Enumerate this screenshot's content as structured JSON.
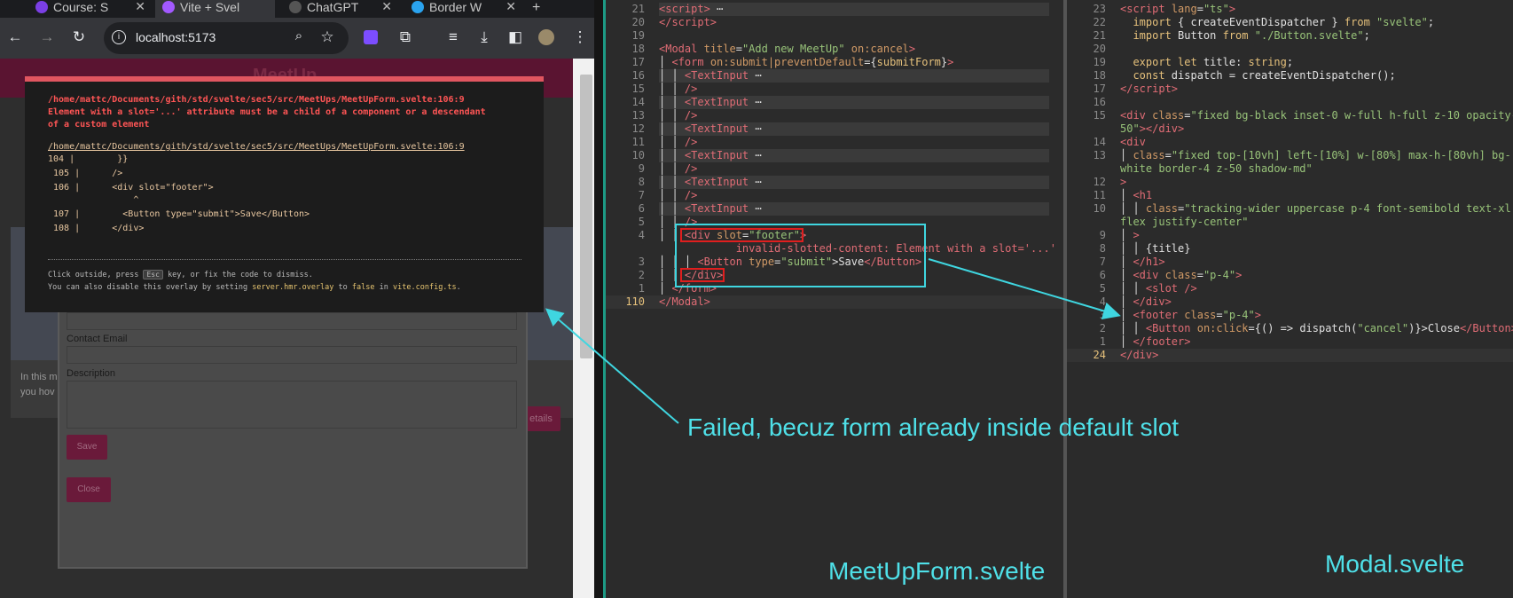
{
  "browser": {
    "tabs": [
      {
        "label": "Course: S",
        "fav_color": "#7b3fe4"
      },
      {
        "label": "Vite + Svel",
        "fav_color": "#a259ff"
      },
      {
        "label": "ChatGPT",
        "fav_color": "#3a3a3a"
      },
      {
        "label": "Border W",
        "fav_color": "#2aa3ef"
      }
    ],
    "new_tab": "+",
    "url": "localhost:5173",
    "page": {
      "logo": "MeetUp",
      "contact_email_label": "Contact Email",
      "description_label": "Description",
      "save_button": "Save",
      "close_button": "Close",
      "bg_details_button": "etails",
      "bg_text_1": "In this m",
      "bg_text_2": "you hov"
    },
    "overlay": {
      "file": "/home/mattc/Documents/gith/std/svelte/sec5/src/MeetUps/MeetUpForm.svelte:106:9",
      "message_1": "Element with a slot='...' attribute must be a child of a component or a descendant",
      "message_2": "of a custom element",
      "link": "/home/mattc/Documents/gith/std/svelte/sec5/src/MeetUps/MeetUpForm.svelte:106:9",
      "code": [
        "104 |        }}",
        " 105 |      />",
        " 106 |      <div slot=\"footer\">",
        "                ^",
        " 107 |        <Button type=\"submit\">Save</Button>",
        " 108 |      </div>"
      ],
      "tip_1a": "Click outside, press",
      "tip_key": "Esc",
      "tip_1b": "key, or fix the code to dismiss.",
      "tip_2a": "You can also disable this overlay by setting",
      "tip_2b": "server.hmr.overlay",
      "tip_2c": "to",
      "tip_2d": "false",
      "tip_2e": "in",
      "tip_2f": "vite.config.ts",
      "tip_2g": "."
    }
  },
  "editor_left": {
    "file_caption": "MeetUpForm.svelte",
    "lines": [
      {
        "n": "21",
        "html": "<span class='t'>&lt;script&gt;</span> <span class='p'>⋯</span>",
        "fold": true
      },
      {
        "n": "20",
        "html": "<span class='t'>&lt;/script&gt;</span>"
      },
      {
        "n": "19",
        "html": ""
      },
      {
        "n": "18",
        "html": "<span class='t'>&lt;Modal</span> <span class='k'>title</span>=<span class='s'>\"Add new MeetUp\"</span> <span class='k'>on:cancel</span><span class='t'>&gt;</span>"
      },
      {
        "n": "17",
        "html": "│ <span class='t'>&lt;form</span> <span class='k'>on:submit|preventDefault</span>={<span class='kw'>submitForm</span>}<span class='t'>&gt;</span>"
      },
      {
        "n": "16",
        "html": "│ │ <span class='t'>&lt;TextInput</span> ⋯",
        "fold": true
      },
      {
        "n": "15",
        "html": "│ │ <span class='t'>/&gt;</span>"
      },
      {
        "n": "14",
        "html": "│ │ <span class='t'>&lt;TextInput</span> ⋯",
        "fold": true
      },
      {
        "n": "13",
        "html": "│ │ <span class='t'>/&gt;</span>"
      },
      {
        "n": "12",
        "html": "│ │ <span class='t'>&lt;TextInput</span> ⋯",
        "fold": true
      },
      {
        "n": "11",
        "html": "│ │ <span class='t'>/&gt;</span>"
      },
      {
        "n": "10",
        "html": "│ │ <span class='t'>&lt;TextInput</span> ⋯",
        "fold": true
      },
      {
        "n": "9",
        "html": "│ │ <span class='t'>/&gt;</span>"
      },
      {
        "n": "8",
        "html": "│ │ <span class='t'>&lt;TextInput</span> ⋯",
        "fold": true
      },
      {
        "n": "7",
        "html": "│ │ <span class='t'>/&gt;</span>"
      },
      {
        "n": "6",
        "html": "│ │ <span class='t'>&lt;TextInput</span> ⋯",
        "fold": true
      },
      {
        "n": "5",
        "html": "│ │ <span class='t'>/&gt;</span>"
      },
      {
        "n": "4",
        "html": "│ │ <span class='t'>&lt;div</span> <span class='k'>slot</span>=<span class='s'>\"footer\"</span><span class='t'>&gt;</span>"
      },
      {
        "n": "",
        "html": "            <span class='t'>invalid-slotted-content: Element with a slot='...'</span>"
      },
      {
        "n": "3",
        "html": "│ │ │ <span class='t'>&lt;Button</span> <span class='k'>type</span>=<span class='s'>\"submit\"</span>&gt;Save<span class='t'>&lt;/Button&gt;</span>"
      },
      {
        "n": "2",
        "html": "│ │ <span class='t'>&lt;/div&gt;</span>"
      },
      {
        "n": "1",
        "html": "│ <span class='t'>&lt;/form&gt;</span>"
      },
      {
        "n": "110",
        "html": "<span class='t'>&lt;/Modal&gt;</span>",
        "current": true
      }
    ]
  },
  "editor_right": {
    "file_caption": "Modal.svelte",
    "lines": [
      {
        "n": "23",
        "html": "<span class='t'>&lt;script</span> <span class='k'>lang</span>=<span class='s'>\"ts\"</span><span class='t'>&gt;</span>"
      },
      {
        "n": "22",
        "html": "  <span class='kw'>import</span> { createEventDispatcher } <span class='kw'>from</span> <span class='s'>\"svelte\"</span>;"
      },
      {
        "n": "21",
        "html": "  <span class='kw'>import</span> Button <span class='kw'>from</span> <span class='s'>\"./Button.svelte\"</span>;"
      },
      {
        "n": "20",
        "html": ""
      },
      {
        "n": "19",
        "html": "  <span class='kw'>export</span> <span class='kw'>let</span> title: <span class='kw'>string</span>;"
      },
      {
        "n": "18",
        "html": "  <span class='kw'>const</span> dispatch = createEventDispatcher();"
      },
      {
        "n": "17",
        "html": "<span class='t'>&lt;/script&gt;</span>"
      },
      {
        "n": "16",
        "html": ""
      },
      {
        "n": "15",
        "html": "<span class='t'>&lt;div</span> <span class='k'>class</span>=<span class='s'>\"fixed bg-black inset-0 w-full h-full z-10 opacity-</span>"
      },
      {
        "n": "",
        "html": "<span class='s'>50\"</span><span class='t'>&gt;&lt;/div&gt;</span>"
      },
      {
        "n": "14",
        "html": "<span class='t'>&lt;div</span>"
      },
      {
        "n": "13",
        "html": "│ <span class='k'>class</span>=<span class='s'>\"fixed top-[10vh] left-[10%] w-[80%] max-h-[80vh] bg-</span>"
      },
      {
        "n": "",
        "html": "<span class='s'>white border-4 z-50 shadow-md\"</span>"
      },
      {
        "n": "12",
        "html": "<span class='t'>&gt;</span>"
      },
      {
        "n": "11",
        "html": "│ <span class='t'>&lt;h1</span>"
      },
      {
        "n": "10",
        "html": "│ │ <span class='k'>class</span>=<span class='s'>\"tracking-wider uppercase p-4 font-semibold text-xl</span>"
      },
      {
        "n": "",
        "html": "<span class='s'>flex justify-center\"</span>"
      },
      {
        "n": "9",
        "html": "│ <span class='t'>&gt;</span>"
      },
      {
        "n": "8",
        "html": "│ │ {title}"
      },
      {
        "n": "7",
        "html": "│ <span class='t'>&lt;/h1&gt;</span>"
      },
      {
        "n": "6",
        "html": "│ <span class='t'>&lt;div</span> <span class='k'>class</span>=<span class='s'>\"p-4\"</span><span class='t'>&gt;</span>"
      },
      {
        "n": "5",
        "html": "│ │ <span class='t'>&lt;slot</span> <span class='t'>/&gt;</span>"
      },
      {
        "n": "4",
        "html": "│ <span class='t'>&lt;/div&gt;</span>"
      },
      {
        "n": "3",
        "html": "│ <span class='t'>&lt;footer</span> <span class='k'>class</span>=<span class='s'>\"p-4\"</span><span class='t'>&gt;</span>"
      },
      {
        "n": "2",
        "html": "│ │ <span class='t'>&lt;Button</span> <span class='k'>on:click</span>={() =&gt; dispatch(<span class='s'>\"cancel\"</span>)}&gt;Close<span class='t'>&lt;/Button&gt;</span>"
      },
      {
        "n": "1",
        "html": "│ <span class='t'>&lt;/footer&gt;</span>"
      },
      {
        "n": "24",
        "html": "<span class='t'>&lt;/div&gt;</span>",
        "current": true
      }
    ]
  },
  "annotation": {
    "text": "Failed, becuz form already inside default slot",
    "color": "#4fe0e8"
  }
}
